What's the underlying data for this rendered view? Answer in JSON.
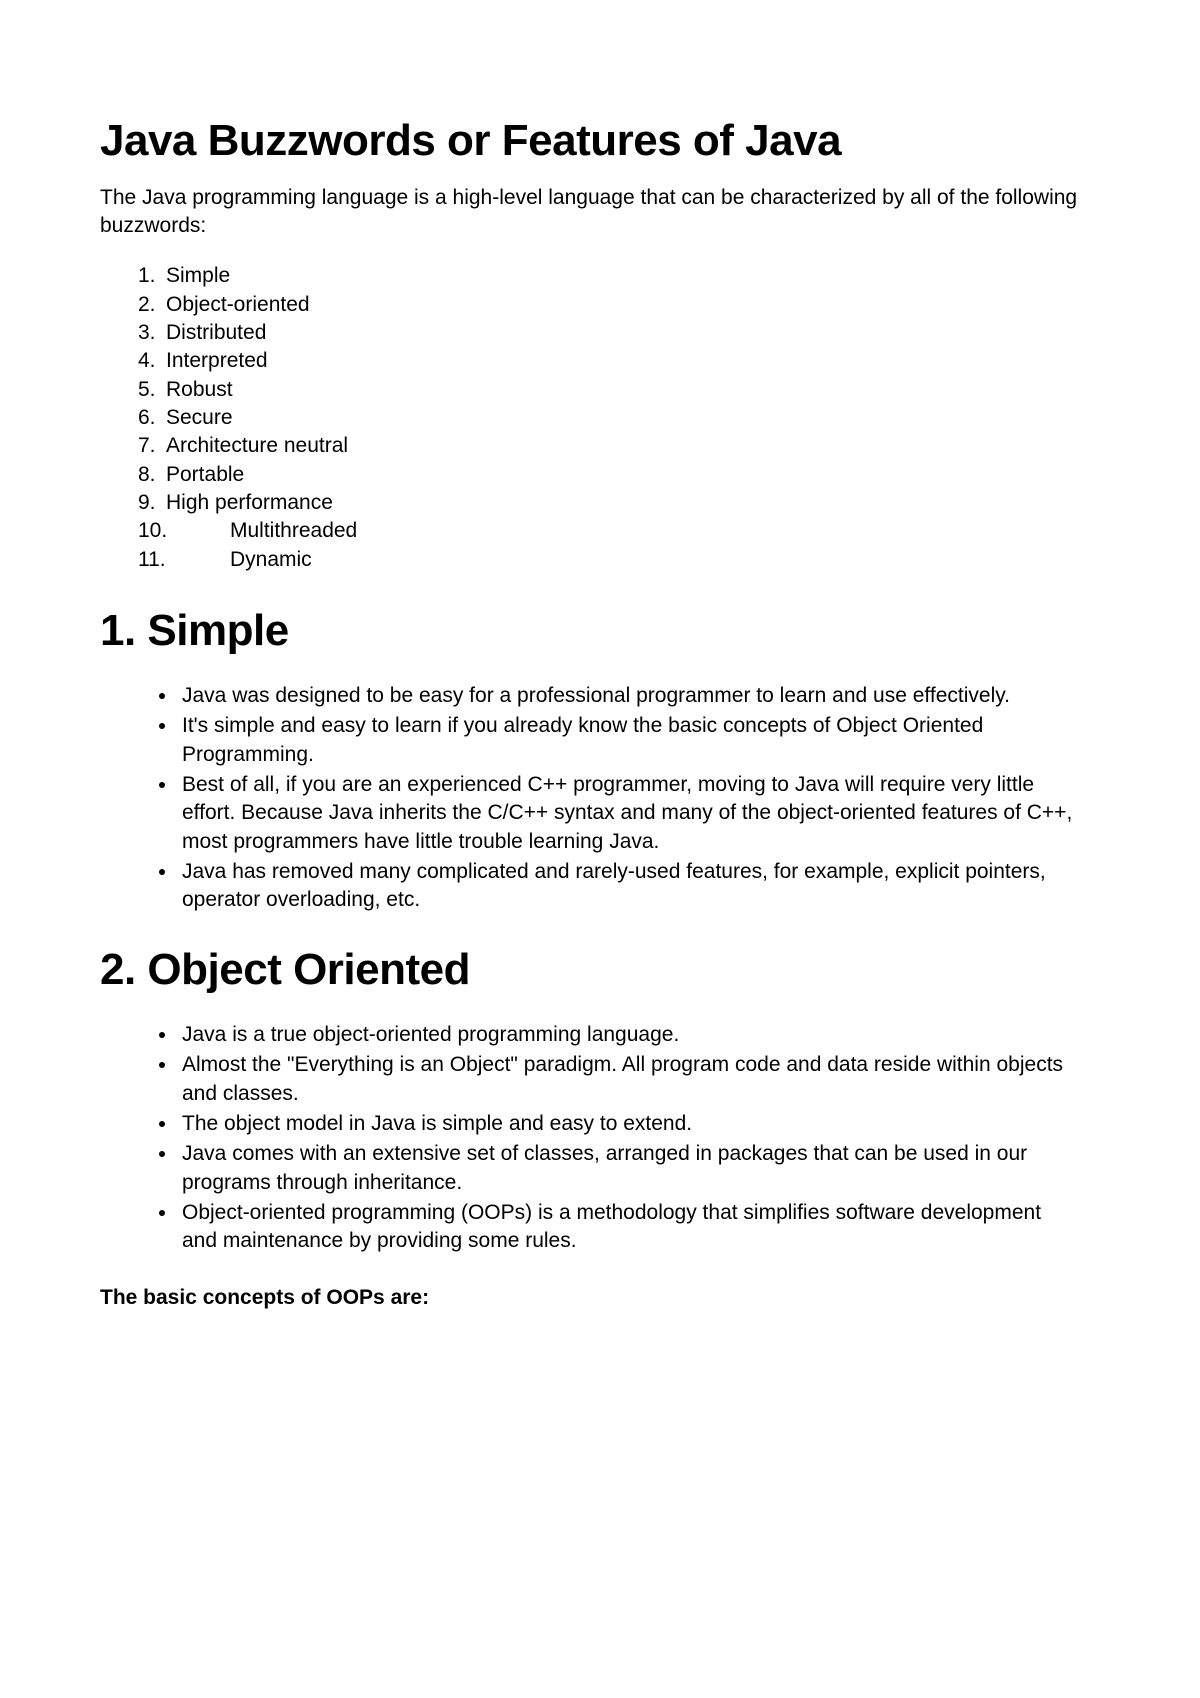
{
  "title": "Java Buzzwords or Features of Java",
  "intro": "The Java programming language is a high-level language that can be characterized by all of the following buzzwords:",
  "buzzwords": [
    "Simple",
    "Object-oriented",
    "Distributed",
    "Interpreted",
    "Robust",
    "Secure",
    "Architecture neutral",
    "Portable",
    "High performance",
    "Multithreaded",
    "Dynamic"
  ],
  "sections": [
    {
      "heading": "1. Simple",
      "bullets": [
        "Java was designed to be easy for a professional programmer to learn and use effectively.",
        "It's simple and easy to learn if you already know the basic concepts of Object Oriented Programming.",
        "Best of all, if you are an experienced C++ programmer, moving to Java will require very little effort. Because Java inherits the C/C++ syntax and many of the object-oriented features of C++, most programmers have little trouble learning Java.",
        "Java has removed many complicated and rarely-used features, for example, explicit pointers, operator overloading, etc."
      ]
    },
    {
      "heading": "2. Object Oriented",
      "bullets": [
        "Java is a true object-oriented programming language.",
        "Almost the \"Everything is an Object\" paradigm. All program code and data reside within objects and classes.",
        "The object model in Java is simple and easy to extend.",
        "Java comes with an extensive set of classes, arranged in packages that can be used in our programs through inheritance.",
        "Object-oriented programming (OOPs) is a methodology that simplifies software development and maintenance by providing some rules."
      ]
    }
  ],
  "subheading": "The basic concepts of OOPs are:"
}
